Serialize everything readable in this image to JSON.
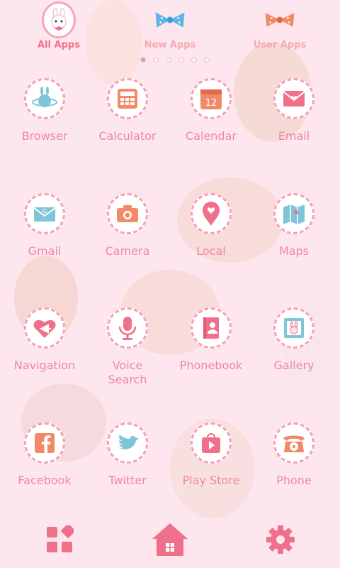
{
  "tabs": {
    "all": "All Apps",
    "new": "New Apps",
    "user": "User Apps"
  },
  "apps": [
    {
      "label": "Browser",
      "icon": "planet-bunny-icon"
    },
    {
      "label": "Calculator",
      "icon": "calculator-icon"
    },
    {
      "label": "Calendar",
      "icon": "calendar-icon",
      "calendar_day": "12"
    },
    {
      "label": "Email",
      "icon": "envelope-heart-icon"
    },
    {
      "label": "Gmail",
      "icon": "gmail-envelope-icon"
    },
    {
      "label": "Camera",
      "icon": "camera-icon"
    },
    {
      "label": "Local",
      "icon": "map-pin-heart-icon"
    },
    {
      "label": "Maps",
      "icon": "folded-map-icon"
    },
    {
      "label": "Navigation",
      "icon": "heart-arrow-icon"
    },
    {
      "label": "Voice\nSearch",
      "icon": "microphone-icon"
    },
    {
      "label": "Phonebook",
      "icon": "contact-book-icon"
    },
    {
      "label": "Gallery",
      "icon": "picture-frame-bunny-icon"
    },
    {
      "label": "Facebook",
      "icon": "facebook-icon"
    },
    {
      "label": "Twitter",
      "icon": "bird-icon"
    },
    {
      "label": "Play Store",
      "icon": "play-bag-icon"
    },
    {
      "label": "Phone",
      "icon": "rotary-phone-icon"
    }
  ],
  "colors": {
    "accent_pink": "#f0879f",
    "icon_pink": "#f06f8a",
    "icon_orange": "#f28a6a",
    "icon_blue": "#7fc4d8",
    "background": "#fde6ee"
  }
}
